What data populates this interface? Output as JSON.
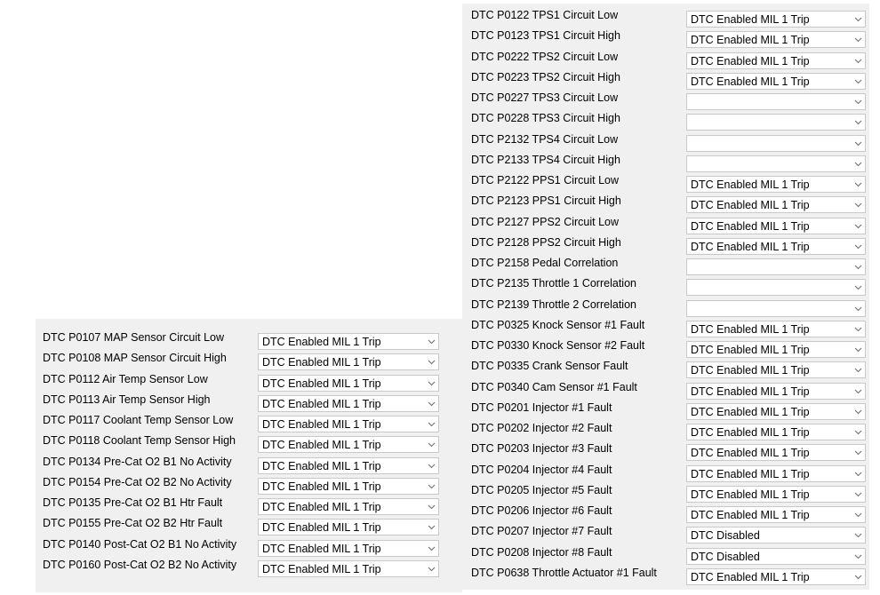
{
  "right_panel": {
    "rows": [
      {
        "label": "DTC P0122 TPS1 Circuit Low",
        "value": "DTC Enabled MIL 1 Trip"
      },
      {
        "label": "DTC P0123 TPS1 Circuit High",
        "value": "DTC Enabled MIL 1 Trip"
      },
      {
        "label": "DTC P0222 TPS2 Circuit Low",
        "value": "DTC Enabled MIL 1 Trip"
      },
      {
        "label": "DTC P0223 TPS2 Circuit High",
        "value": "DTC Enabled MIL 1 Trip"
      },
      {
        "label": "DTC P0227 TPS3 Circuit Low",
        "value": ""
      },
      {
        "label": "DTC P0228 TPS3 Circuit High",
        "value": ""
      },
      {
        "label": "DTC P2132 TPS4 Circuit Low",
        "value": ""
      },
      {
        "label": "DTC P2133 TPS4 Circuit High",
        "value": ""
      },
      {
        "label": "DTC P2122 PPS1 Circuit Low",
        "value": "DTC Enabled MIL 1 Trip"
      },
      {
        "label": "DTC P2123 PPS1 Circuit High",
        "value": "DTC Enabled MIL 1 Trip"
      },
      {
        "label": "DTC P2127 PPS2 Circuit Low",
        "value": "DTC Enabled MIL 1 Trip"
      },
      {
        "label": "DTC P2128 PPS2 Circuit High",
        "value": "DTC Enabled MIL 1 Trip"
      },
      {
        "label": "DTC P2158 Pedal Correlation",
        "value": ""
      },
      {
        "label": "DTC P2135 Throttle 1 Correlation",
        "value": ""
      },
      {
        "label": "DTC P2139 Throttle 2 Correlation",
        "value": ""
      },
      {
        "label": "DTC P0325 Knock Sensor #1 Fault",
        "value": "DTC Enabled MIL 1 Trip"
      },
      {
        "label": "DTC P0330 Knock Sensor #2 Fault",
        "value": "DTC Enabled MIL 1 Trip"
      },
      {
        "label": "DTC P0335 Crank Sensor Fault",
        "value": "DTC Enabled MIL 1 Trip"
      },
      {
        "label": "DTC P0340 Cam Sensor #1 Fault",
        "value": "DTC Enabled MIL 1 Trip"
      },
      {
        "label": "DTC P0201 Injector #1 Fault",
        "value": "DTC Enabled MIL 1 Trip"
      },
      {
        "label": "DTC P0202 Injector #2 Fault",
        "value": "DTC Enabled MIL 1 Trip"
      },
      {
        "label": "DTC P0203 Injector #3 Fault",
        "value": "DTC Enabled MIL 1 Trip"
      },
      {
        "label": "DTC P0204 Injector #4 Fault",
        "value": "DTC Enabled MIL 1 Trip"
      },
      {
        "label": "DTC P0205 Injector #5 Fault",
        "value": "DTC Enabled MIL 1 Trip"
      },
      {
        "label": "DTC P0206 Injector #6 Fault",
        "value": "DTC Enabled MIL 1 Trip"
      },
      {
        "label": "DTC P0207 Injector #7 Fault",
        "value": "DTC Disabled"
      },
      {
        "label": "DTC P0208 Injector #8 Fault",
        "value": "DTC Disabled"
      },
      {
        "label": "DTC P0638 Throttle Actuator #1 Fault",
        "value": "DTC Enabled MIL 1 Trip"
      }
    ]
  },
  "left_panel": {
    "rows": [
      {
        "label": "DTC P0107 MAP Sensor Circuit Low",
        "value": "DTC Enabled MIL 1 Trip"
      },
      {
        "label": "DTC P0108 MAP Sensor Circuit High",
        "value": "DTC Enabled MIL 1 Trip"
      },
      {
        "label": "DTC P0112 Air Temp Sensor Low",
        "value": "DTC Enabled MIL 1 Trip"
      },
      {
        "label": "DTC P0113 Air Temp Sensor High",
        "value": "DTC Enabled MIL 1 Trip"
      },
      {
        "label": "DTC P0117 Coolant Temp Sensor Low",
        "value": "DTC Enabled MIL 1 Trip"
      },
      {
        "label": "DTC P0118 Coolant Temp Sensor High",
        "value": "DTC Enabled MIL 1 Trip"
      },
      {
        "label": "DTC P0134 Pre-Cat O2 B1 No Activity",
        "value": "DTC Enabled MIL 1 Trip"
      },
      {
        "label": "DTC P0154 Pre-Cat O2 B2 No Activity",
        "value": "DTC Enabled MIL 1 Trip"
      },
      {
        "label": "DTC P0135 Pre-Cat O2 B1 Htr Fault",
        "value": "DTC Enabled MIL 1 Trip"
      },
      {
        "label": "DTC P0155 Pre-Cat O2 B2 Htr Fault",
        "value": "DTC Enabled MIL 1 Trip"
      },
      {
        "label": "DTC P0140 Post-Cat O2 B1 No Activity",
        "value": "DTC Enabled MIL 1 Trip"
      },
      {
        "label": "DTC P0160 Post-Cat O2 B2 No Activity",
        "value": "DTC Enabled MIL 1 Trip"
      }
    ]
  },
  "icons": {
    "dropdown_arrow": "chevron-down-icon"
  },
  "colors": {
    "panel_bg": "#f0f0f0",
    "combo_border": "#c9c9c9",
    "arrow": "#6e6e6e"
  }
}
